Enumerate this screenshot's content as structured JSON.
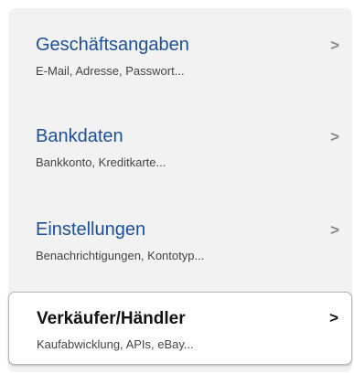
{
  "menu": {
    "items": [
      {
        "title": "Geschäftsangaben",
        "subtitle": "E-Mail, Adresse, Passwort...",
        "chevron": ">",
        "selected": false
      },
      {
        "title": "Bankdaten",
        "subtitle": "Bankkonto, Kreditkarte...",
        "chevron": ">",
        "selected": false
      },
      {
        "title": "Einstellungen",
        "subtitle": "Benachrichtigungen, Kontotyp...",
        "chevron": ">",
        "selected": false
      },
      {
        "title": "Verkäufer/Händler",
        "subtitle": "Kaufabwicklung, APIs, eBay...",
        "chevron": ">",
        "selected": true
      }
    ]
  },
  "colors": {
    "link_blue": "#1b4f9c",
    "panel_bg": "#f2f2f2",
    "selected_bg": "#ffffff"
  }
}
